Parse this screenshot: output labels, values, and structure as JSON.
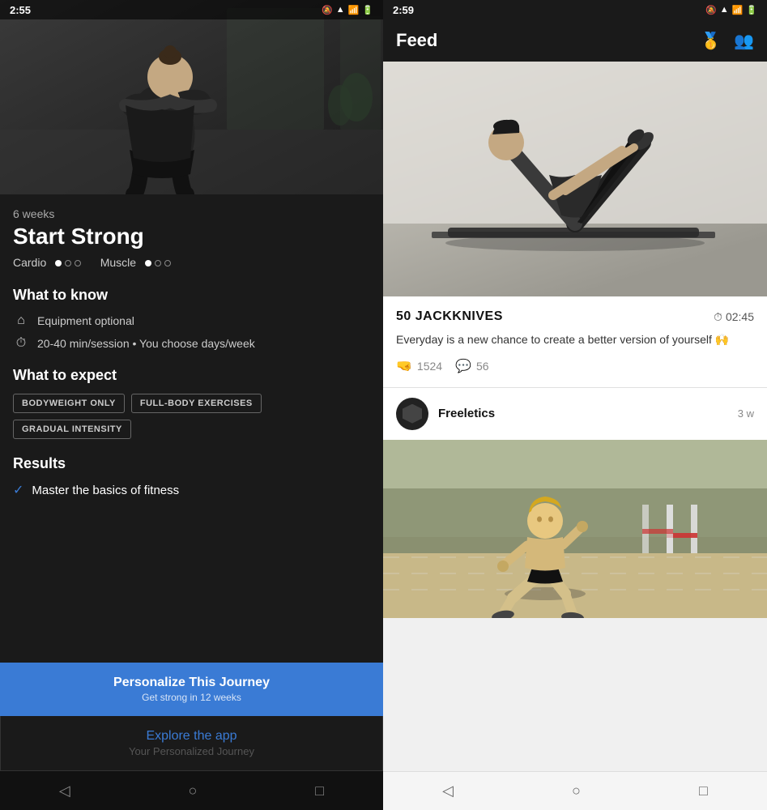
{
  "left": {
    "status": {
      "time": "2:55",
      "icons": [
        "🔔",
        "▲",
        "📶",
        "🔋"
      ]
    },
    "program": {
      "weeks": "6 weeks",
      "title": "Start Strong",
      "cardio_label": "Cardio",
      "muscle_label": "Muscle",
      "cardio_dots": [
        true,
        false,
        false
      ],
      "muscle_dots": [
        true,
        false,
        false
      ]
    },
    "what_to_know": {
      "heading": "What to know",
      "items": [
        {
          "icon": "🏠",
          "text": "Equipment optional"
        },
        {
          "icon": "⏱",
          "text": "20-40 min/session • You choose days/week"
        }
      ]
    },
    "what_to_expect": {
      "heading": "What to expect",
      "tags": [
        "BODYWEIGHT ONLY",
        "FULL-BODY EXERCISES",
        "GRADUAL INTENSITY"
      ]
    },
    "results": {
      "heading": "Results",
      "items": [
        "Master the basics of fitness"
      ]
    },
    "buttons": {
      "personalize_main": "Personalize This Journey",
      "personalize_sub": "Get strong in 12 weeks",
      "explore_main": "Explore the app",
      "explore_sub": "Your Personalized Journey"
    },
    "nav": [
      "◁",
      "○",
      "□"
    ]
  },
  "right": {
    "status": {
      "time": "2:59",
      "icons": [
        "🔔",
        "▲",
        "📶",
        "🔋"
      ]
    },
    "header": {
      "title": "Feed",
      "icon1": "🥇",
      "icon2": "👥"
    },
    "workout_card": {
      "name": "50 JACKKNIVES",
      "time": "02:45",
      "quote": "Everyday is a new chance to create a better version of yourself 🙌",
      "likes": "1524",
      "comments": "56"
    },
    "post": {
      "username": "Freeletics",
      "time_ago": "3 w"
    },
    "nav": [
      "◁",
      "○",
      "□"
    ]
  }
}
